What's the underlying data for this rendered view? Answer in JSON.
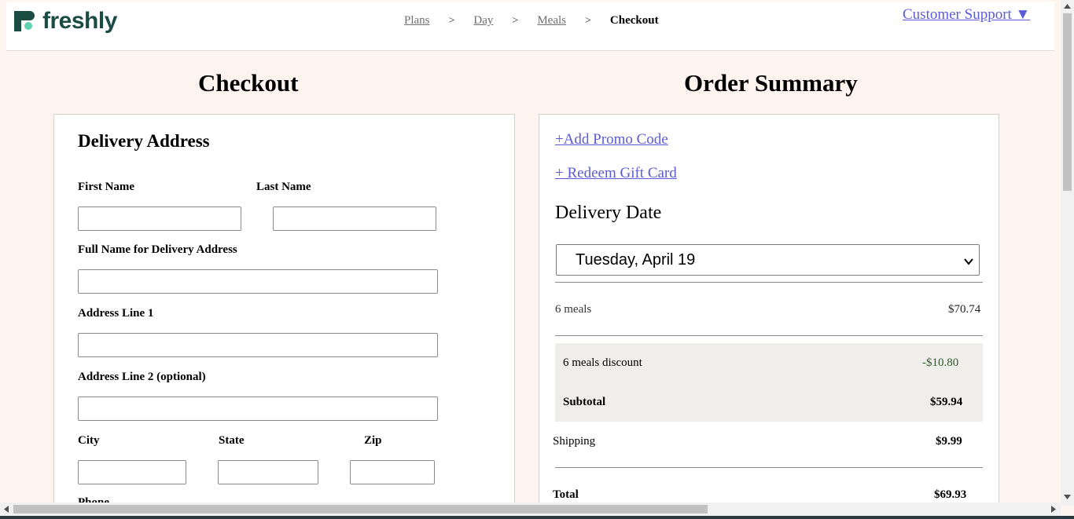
{
  "brand": {
    "name": "freshly",
    "color": "#1b4c43",
    "accent": "#5ed1b0"
  },
  "breadcrumb": [
    {
      "label": "Plans"
    },
    {
      "label": "Day"
    },
    {
      "label": "Meals"
    },
    {
      "label": "Checkout"
    }
  ],
  "breadcrumb_sep": ">",
  "support": {
    "label": "Customer Support ▼"
  },
  "checkout": {
    "title": "Checkout",
    "section": "Delivery Address",
    "fields": {
      "first_name": "First Name",
      "last_name": "Last Name",
      "full_name": "Full Name for Delivery Address",
      "address1": "Address Line 1",
      "address2": "Address Line 2 (optional)",
      "city": "City",
      "state": "State",
      "zip": "Zip",
      "phone": "Phone"
    }
  },
  "summary": {
    "title": "Order Summary",
    "promo_link": "+Add Promo Code",
    "gift_link": "+ Redeem Gift Card",
    "delivery_label": "Delivery Date",
    "delivery_selected": "Tuesday, April 19",
    "meals_label": "6 meals",
    "meals_price": "$70.74",
    "discount_label": "6 meals discount",
    "discount_value": "-$10.80",
    "subtotal_label": "Subtotal",
    "subtotal_value": "$59.94",
    "shipping_label": "Shipping",
    "shipping_value": "$9.99",
    "total_label": "Total",
    "total_value": "$69.93"
  },
  "colors": {
    "link": "#5b5bd6",
    "discount": "#2f5a2a",
    "background": "#fdf4ef"
  }
}
